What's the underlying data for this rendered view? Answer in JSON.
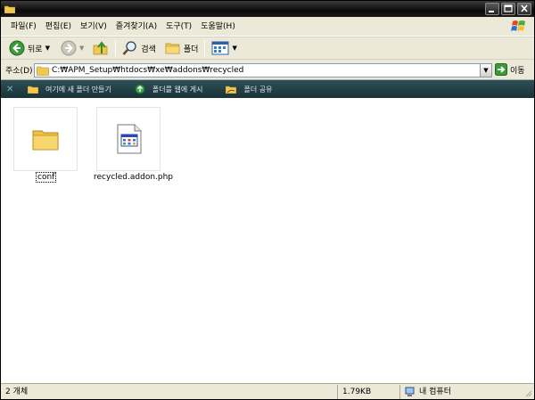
{
  "window": {
    "title": ""
  },
  "menu": {
    "items": [
      "파일(F)",
      "편집(E)",
      "보기(V)",
      "즐겨찾기(A)",
      "도구(T)",
      "도움말(H)"
    ]
  },
  "toolbar": {
    "back_label": "뒤로",
    "search_label": "검색",
    "folders_label": "폴더"
  },
  "address": {
    "label": "주소(D)",
    "path": "C:₩APM_Setup₩htdocs₩xe₩addons₩recycled",
    "go_label": "이동"
  },
  "tasks": {
    "items": [
      "여기에 새 폴더 만들기",
      "폴더를 웹에 게시",
      "폴더 공유"
    ]
  },
  "files": [
    {
      "name": "conf",
      "type": "folder",
      "selected": true
    },
    {
      "name": "recycled.addon.php",
      "type": "php-file",
      "selected": false
    }
  ],
  "status": {
    "count": "2 개체",
    "size": "1.79KB",
    "location": "내 컴퓨터"
  },
  "colors": {
    "titlebar": "#111111",
    "menubar": "#ece9d8",
    "taskbar": "#2e4f56",
    "go_green": "#3c9a3c"
  }
}
